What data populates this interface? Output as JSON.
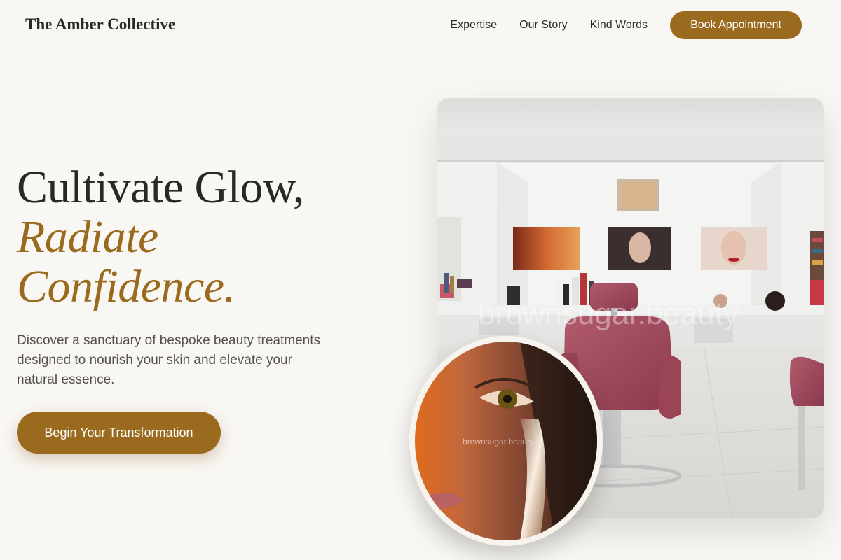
{
  "header": {
    "brand": "The Amber Collective",
    "nav": [
      "Expertise",
      "Our Story",
      "Kind Words"
    ],
    "book_label": "Book Appointment"
  },
  "hero": {
    "title_line1": "Cultivate Glow,",
    "title_accent_line1": "Radiate",
    "title_accent_line2": "Confidence.",
    "subtitle": "Discover a sanctuary of bespoke beauty treatments designed to nourish your skin and elevate your natural essence.",
    "cta_label": "Begin Your Transformation"
  },
  "images": {
    "salon_watermark": "brownsugar.beauty",
    "portrait_watermark": "brownsugar.beauty"
  },
  "colors": {
    "background": "#f9f7f3",
    "accent": "#9a6a1e",
    "text": "#2a2824"
  }
}
